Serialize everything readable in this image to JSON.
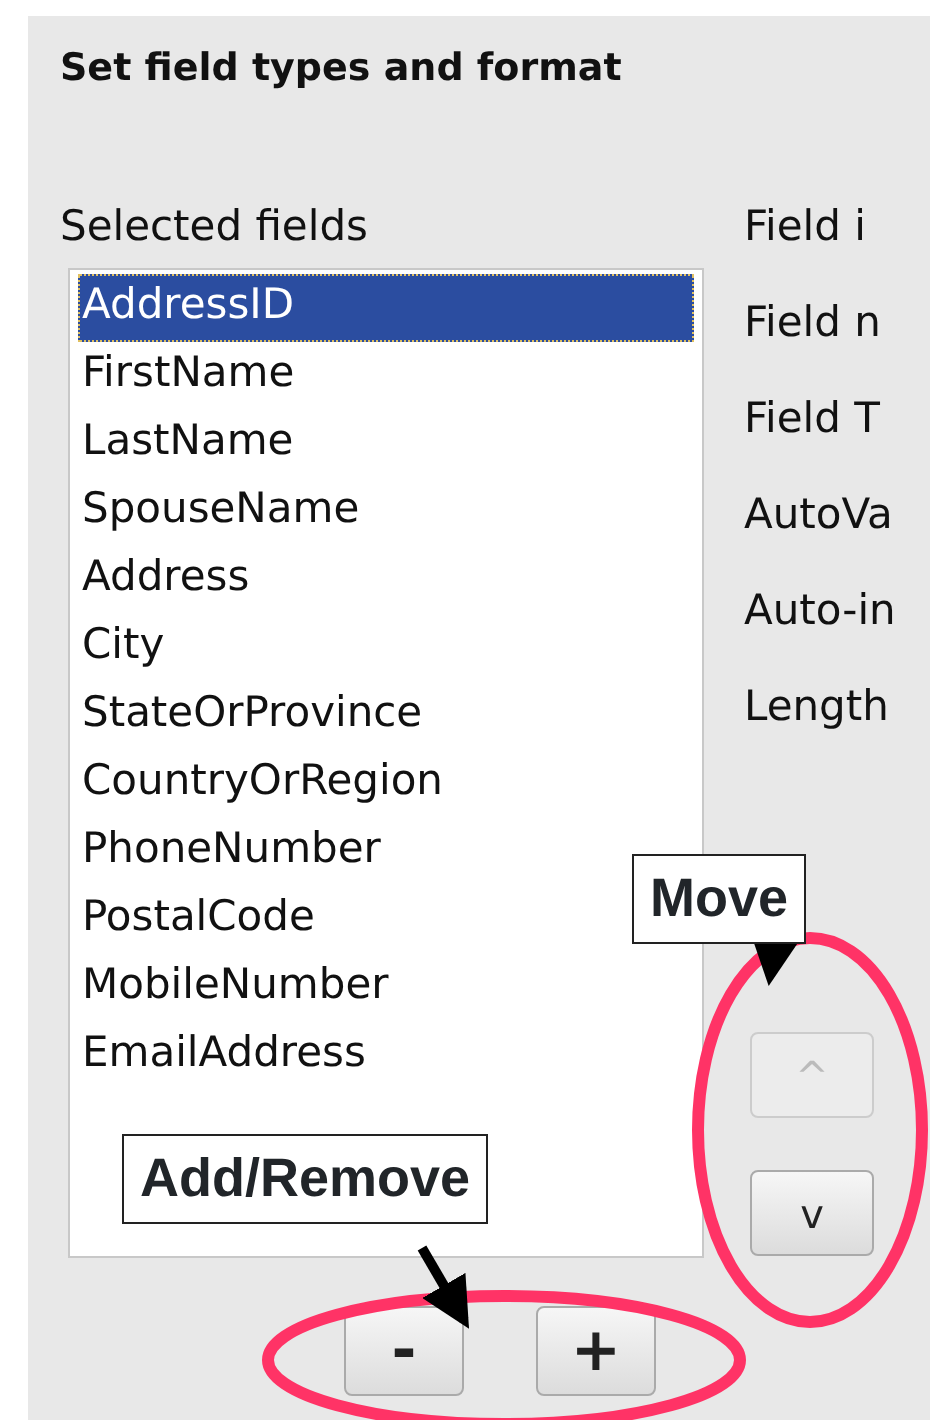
{
  "title": "Set field types and format",
  "selected_fields": {
    "label": "Selected fields",
    "items": [
      {
        "text": "AddressID",
        "selected": true
      },
      {
        "text": "FirstName",
        "selected": false
      },
      {
        "text": "LastName",
        "selected": false
      },
      {
        "text": "SpouseName",
        "selected": false
      },
      {
        "text": "Address",
        "selected": false
      },
      {
        "text": "City",
        "selected": false
      },
      {
        "text": "StateOrProvince",
        "selected": false
      },
      {
        "text": "CountryOrRegion",
        "selected": false
      },
      {
        "text": "PhoneNumber",
        "selected": false
      },
      {
        "text": "PostalCode",
        "selected": false
      },
      {
        "text": "MobileNumber",
        "selected": false
      },
      {
        "text": "EmailAddress",
        "selected": false
      }
    ]
  },
  "field_info_labels": [
    {
      "text": "Field i"
    },
    {
      "text": "Field n"
    },
    {
      "text": "Field T"
    },
    {
      "text": "AutoVa"
    },
    {
      "text": "Auto-in"
    },
    {
      "text": "Length"
    }
  ],
  "move_buttons": [
    {
      "text": "^",
      "disabled": true
    },
    {
      "text": "v",
      "disabled": false
    }
  ],
  "list_buttons": [
    {
      "text": "-",
      "disabled": false
    },
    {
      "text": "+",
      "disabled": false
    }
  ],
  "annotations": [
    {
      "text": "Move"
    },
    {
      "text": "Add/Remove"
    }
  ]
}
